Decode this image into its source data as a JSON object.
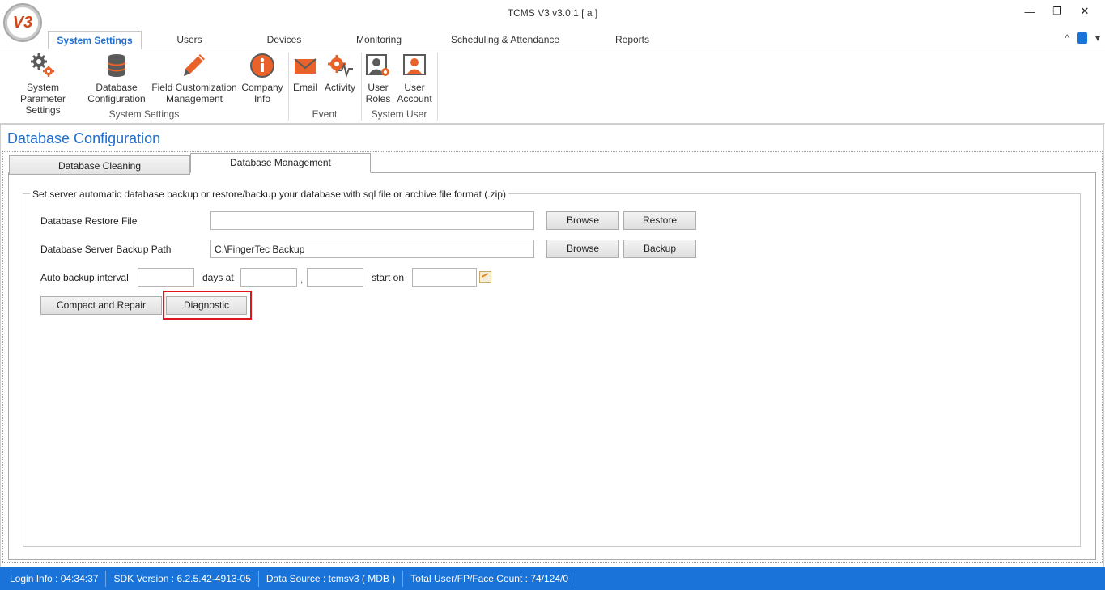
{
  "app": {
    "logo_text": "V3",
    "title": "TCMS V3 v3.0.1 [ a ]",
    "window_controls": {
      "minimize": "—",
      "restore": "❐",
      "close": "✕"
    }
  },
  "ribbon_tabs": [
    {
      "label": "System Settings",
      "active": true
    },
    {
      "label": "Users"
    },
    {
      "label": "Devices"
    },
    {
      "label": "Monitoring"
    },
    {
      "label": "Scheduling & Attendance"
    },
    {
      "label": "Reports"
    }
  ],
  "ribbon_right": {
    "collapse": "^",
    "menu": "▾"
  },
  "ribbon_groups": [
    {
      "label": "System Settings",
      "buttons": [
        {
          "line1": "System Parameter",
          "line2": "Settings",
          "icon": "gears-icon"
        },
        {
          "line1": "Database",
          "line2": "Configuration",
          "icon": "database-icon"
        },
        {
          "line1": "Field Customization",
          "line2": "Management",
          "icon": "pencil-icon"
        },
        {
          "line1": "Company",
          "line2": "Info",
          "icon": "info-icon"
        }
      ]
    },
    {
      "label": "Event",
      "buttons": [
        {
          "line1": "Email",
          "line2": "",
          "icon": "email-icon"
        },
        {
          "line1": "Activity",
          "line2": "",
          "icon": "activity-icon"
        }
      ]
    },
    {
      "label": "System User",
      "buttons": [
        {
          "line1": "User",
          "line2": "Roles",
          "icon": "user-roles-icon"
        },
        {
          "line1": "User",
          "line2": "Account",
          "icon": "user-account-icon"
        }
      ]
    }
  ],
  "page": {
    "title": "Database Configuration",
    "tabs": [
      {
        "label": "Database Cleaning"
      },
      {
        "label": "Database Management",
        "active": true
      }
    ],
    "group_caption": "Set server automatic database backup or restore/backup your database with sql file or archive file format (.zip)",
    "restore": {
      "label": "Database Restore File",
      "value": "",
      "browse": "Browse",
      "action": "Restore"
    },
    "backup": {
      "label": "Database Server Backup Path",
      "value": "C:\\FingerTec Backup",
      "browse": "Browse",
      "action": "Backup"
    },
    "auto_backup": {
      "label": "Auto backup interval",
      "interval": "",
      "days_at": "days at",
      "hour": "",
      "comma": ",",
      "minute": "",
      "start_on": "start on",
      "date": ""
    },
    "compact_repair": "Compact and Repair",
    "diagnostic": "Diagnostic"
  },
  "status": [
    "Login Info : 04:34:37",
    "SDK Version : 6.2.5.42-4913-05",
    "Data Source : tcmsv3 ( MDB )",
    "Total User/FP/Face Count : 74/124/0"
  ],
  "colors": {
    "accent": "#1f6fd1",
    "statusbar": "#1a73d9",
    "icon_orange": "#e8622a",
    "highlight": "#e0141c"
  }
}
